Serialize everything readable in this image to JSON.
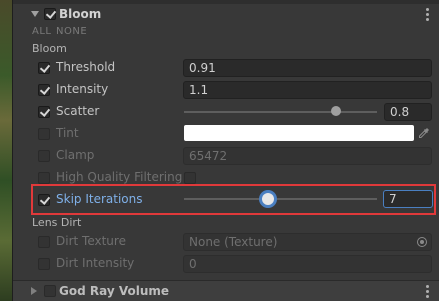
{
  "bloom": {
    "title": "Bloom",
    "enabled": true,
    "all_label": "ALL",
    "none_label": "NONE",
    "group_label": "Bloom",
    "rows": [
      {
        "key": "threshold",
        "label": "Threshold",
        "checked": true,
        "value": "0.91"
      },
      {
        "key": "intensity",
        "label": "Intensity",
        "checked": true,
        "value": "1.1"
      },
      {
        "key": "scatter",
        "label": "Scatter",
        "checked": true,
        "value": "0.8",
        "slider_fraction": 0.82
      },
      {
        "key": "tint",
        "label": "Tint",
        "checked": false,
        "color": "#ffffff"
      },
      {
        "key": "clamp",
        "label": "Clamp",
        "checked": false,
        "value": "65472"
      },
      {
        "key": "high_quality_filtering",
        "label": "High Quality Filtering",
        "checked": false
      },
      {
        "key": "skip_iterations",
        "label": "Skip Iterations",
        "checked": true,
        "value": "7",
        "slider_fraction": 0.4
      }
    ]
  },
  "lens_dirt": {
    "group_label": "Lens Dirt",
    "rows": [
      {
        "key": "dirt_texture",
        "label": "Dirt Texture",
        "checked": false,
        "value": "None (Texture)"
      },
      {
        "key": "dirt_intensity",
        "label": "Dirt Intensity",
        "checked": false,
        "value": "0"
      }
    ]
  },
  "god_ray": {
    "title": "God Ray Volume",
    "enabled": false
  },
  "colors": {
    "accent": "#4a7fc1",
    "highlight": "#e0393a",
    "label_active": "#7fb0e8"
  },
  "icons": [
    "foldout-arrow-icon",
    "kebab-menu-icon",
    "eyedropper-icon",
    "object-picker-icon"
  ]
}
